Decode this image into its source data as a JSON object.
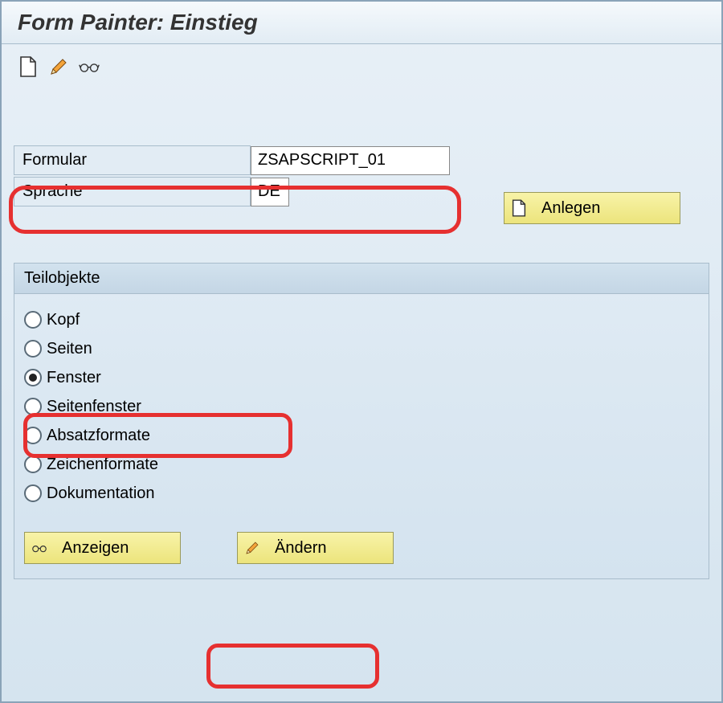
{
  "title": "Form Painter: Einstieg",
  "toolbar": {
    "icons": [
      "document-blank-icon",
      "pencil-icon",
      "glasses-icon"
    ]
  },
  "fields": {
    "form_label": "Formular",
    "form_value": "ZSAPSCRIPT_01",
    "lang_label": "Sprache",
    "lang_value": "DE"
  },
  "buttons": {
    "anlegen_label": "Anlegen",
    "anzeigen_label": "Anzeigen",
    "aendern_label": "Ändern"
  },
  "groupbox": {
    "title": "Teilobjekte",
    "options": [
      {
        "label": "Kopf",
        "selected": false
      },
      {
        "label": "Seiten",
        "selected": false
      },
      {
        "label": "Fenster",
        "selected": true
      },
      {
        "label": "Seitenfenster",
        "selected": false
      },
      {
        "label": "Absatzformate",
        "selected": false
      },
      {
        "label": "Zeichenformate",
        "selected": false
      },
      {
        "label": "Dokumentation",
        "selected": false
      }
    ]
  }
}
